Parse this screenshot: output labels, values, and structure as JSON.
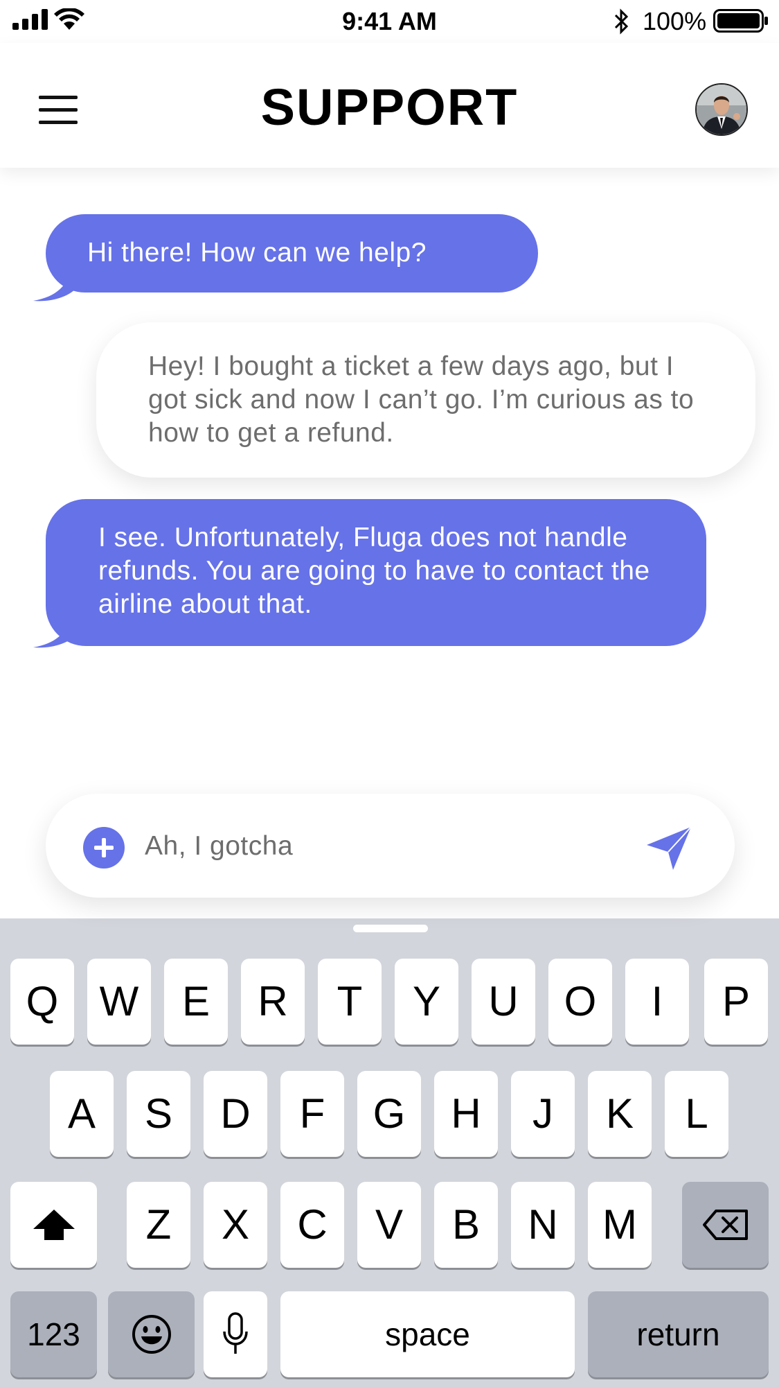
{
  "status_bar": {
    "time": "9:41 AM",
    "battery_percent": "100%",
    "signal_icon": "cellular-signal-icon",
    "wifi_icon": "wifi-icon",
    "bluetooth_icon": "bluetooth-icon",
    "battery_icon": "battery-icon"
  },
  "header": {
    "title": "SUPPORT",
    "menu_icon": "hamburger-menu-icon",
    "avatar": "user-avatar"
  },
  "messages": [
    {
      "sender": "agent",
      "text": "Hi there! How can we help?"
    },
    {
      "sender": "user",
      "text": "Hey! I bought a ticket a few days ago, but I got sick and now I can’t go. I’m curious as to how to get a refund."
    },
    {
      "sender": "agent",
      "text": "I see. Unfortunately, Fluga does not handle refunds. You are going to have to contact the airline about that."
    }
  ],
  "composer": {
    "value": "Ah, I gotcha",
    "add_icon": "plus-circle-icon",
    "send_icon": "send-paper-plane-icon"
  },
  "keyboard": {
    "row1": [
      "Q",
      "W",
      "E",
      "R",
      "T",
      "Y",
      "U",
      "O",
      "I",
      "P"
    ],
    "row2": [
      "A",
      "S",
      "D",
      "F",
      "G",
      "H",
      "J",
      "K",
      "L"
    ],
    "row3": [
      "Z",
      "X",
      "C",
      "V",
      "B",
      "N",
      "M"
    ],
    "shift_icon": "shift-arrow-icon",
    "backspace_icon": "backspace-icon",
    "numbers_label": "123",
    "emoji_icon": "emoji-icon",
    "mic_icon": "microphone-icon",
    "space_label": "space",
    "return_label": "return"
  },
  "colors": {
    "accent": "#6672e8",
    "user_text": "#6d6d6d",
    "keyboard_bg": "#d2d5db",
    "dark_key": "#abb0ba"
  }
}
